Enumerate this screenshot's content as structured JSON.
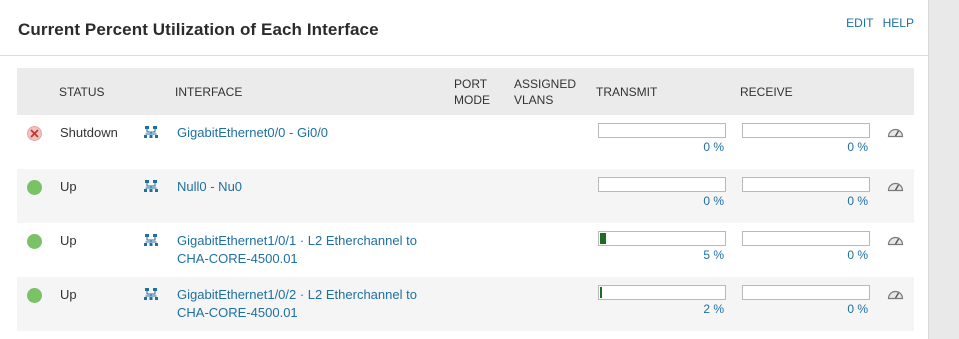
{
  "panel": {
    "title": "Current Percent Utilization of Each Interface",
    "edit_label": "EDIT",
    "help_label": "HELP"
  },
  "columns": {
    "status": "STATUS",
    "interface": "INTERFACE",
    "port_mode_1": "PORT",
    "port_mode_2": "MODE",
    "assigned_vlans_1": "ASSIGNED",
    "assigned_vlans_2": "VLANS",
    "transmit": "TRANSMIT",
    "receive": "RECEIVE"
  },
  "rows": [
    {
      "status": "Shutdown",
      "status_icon": "shutdown-x-icon",
      "interface_line1": "GigabitEthernet0/0 - Gi0/0",
      "interface_line2": "",
      "transmit_pct": 0,
      "transmit_label": "0 %",
      "receive_pct": 0,
      "receive_label": "0 %"
    },
    {
      "status": "Up",
      "status_icon": "status-up-icon",
      "interface_line1": "Null0 - Nu0",
      "interface_line2": "",
      "transmit_pct": 0,
      "transmit_label": "0 %",
      "receive_pct": 0,
      "receive_label": "0 %"
    },
    {
      "status": "Up",
      "status_icon": "status-up-icon",
      "interface_line1": "GigabitEthernet1/0/1 · L2 Etherchannel to",
      "interface_line2": "CHA-CORE-4500.01",
      "transmit_pct": 5,
      "transmit_label": "5 %",
      "receive_pct": 0,
      "receive_label": "0 %"
    },
    {
      "status": "Up",
      "status_icon": "status-up-icon",
      "interface_line1": "GigabitEthernet1/0/2 · L2 Etherchannel to",
      "interface_line2": "CHA-CORE-4500.01",
      "transmit_pct": 2,
      "transmit_label": "2 %",
      "receive_pct": 0,
      "receive_label": "0 %"
    }
  ],
  "colors": {
    "link": "#1e6fa3",
    "status_up": "#79c265",
    "status_down": "#f1c3c3",
    "bar_fill": "#1e6b24"
  }
}
